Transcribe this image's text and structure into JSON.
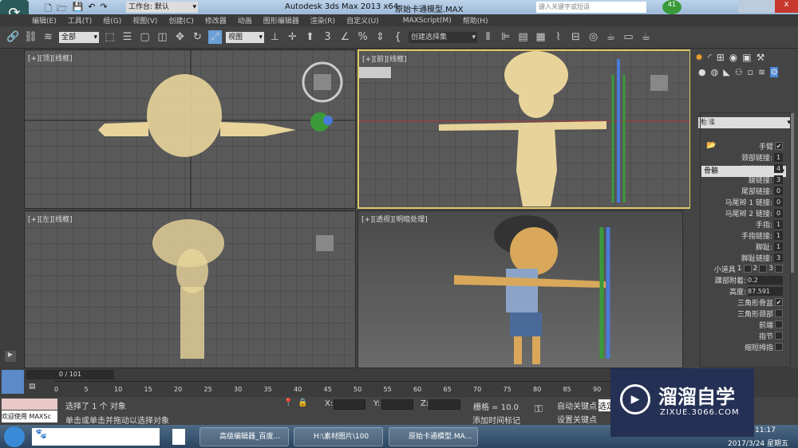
{
  "titlebar": {
    "app_title": "Autodesk 3ds Max  2013 x64",
    "file_name": "原始卡通模型.MAX",
    "workspace": "工作台: 默认",
    "search_placeholder": "键入关键字或短语",
    "badge": "41"
  },
  "menu": [
    "编辑(E)",
    "工具(T)",
    "组(G)",
    "视图(V)",
    "创建(C)",
    "修改器",
    "动画",
    "图形编辑器",
    "渲染(R)",
    "自定义(U)",
    "MAXScript(M)",
    "帮助(H)"
  ],
  "toolbar": {
    "filter": "全部",
    "ref_coord": "视图",
    "named_selection": "创建选择集",
    "snap_3": "3",
    "snap_pct": "%"
  },
  "viewports": [
    {
      "label": "[+][顶][线框]"
    },
    {
      "label": "[+][前][线框]"
    },
    {
      "label": "[+][左][线框]"
    },
    {
      "label": "[+][透视][明暗处理]"
    }
  ],
  "command_panel": {
    "category": "标准",
    "trunk_group": "躯干类型",
    "trunk_type": "骨骼",
    "params": [
      {
        "label": "手臂",
        "type": "check",
        "checked": true
      },
      {
        "label": "颈部链接:",
        "value": "1"
      },
      {
        "label": "脊椎链接:",
        "value": "4"
      },
      {
        "label": "腿链接:",
        "value": "3"
      },
      {
        "label": "尾部链接:",
        "value": "0"
      },
      {
        "label": "马尾辫 1 链接:",
        "value": "0"
      },
      {
        "label": "马尾辫 2 链接:",
        "value": "0"
      },
      {
        "label": "手指:",
        "value": "1"
      },
      {
        "label": "手指链接:",
        "value": "1"
      },
      {
        "label": "脚趾:",
        "value": "1"
      },
      {
        "label": "脚趾链接:",
        "value": "3"
      }
    ],
    "props_label": "小道具",
    "props": [
      "1",
      "2",
      "3"
    ],
    "ankle_label": "踝部附着:",
    "ankle": "0.2",
    "height_label": "高度:",
    "height": "87.591",
    "checks": [
      {
        "label": "三角形骨盆",
        "checked": true
      },
      {
        "label": "三角形颈部",
        "checked": false
      },
      {
        "label": "前端",
        "checked": false
      },
      {
        "label": "指节",
        "checked": false
      },
      {
        "label": "缩短拇指",
        "checked": false
      }
    ]
  },
  "timeline": {
    "frame": "0 / 101",
    "ticks": [
      "0",
      "5",
      "10",
      "15",
      "20",
      "25",
      "30",
      "35",
      "40",
      "45",
      "50",
      "55",
      "60",
      "65",
      "70",
      "75",
      "80",
      "85",
      "90"
    ]
  },
  "status": {
    "maxscript": "欢迎使用 MAXSc",
    "selected": "选择了 1 个 对象",
    "prompt": "单击或单击并拖动以选择对象",
    "x": "X:",
    "y": "Y:",
    "z": "Z:",
    "grid": "栅格 = 10.0",
    "auto_key": "自动关键点",
    "set_key": "设置关键点",
    "add_tag": "添加时间标记",
    "sel": "选定"
  },
  "taskbar": {
    "tasks": [
      "高级编辑器_百度...",
      "H:\\素材图片\\100",
      "原始卡通模型.MA..."
    ],
    "time": "11:17",
    "date": "2017/3/24 星期五"
  },
  "watermark": {
    "brand": "溜溜自学",
    "url": "ZIXUE.3066.COM"
  },
  "colors": {
    "wireframe": "#e8d49a",
    "active_border": "#e3c96a"
  }
}
